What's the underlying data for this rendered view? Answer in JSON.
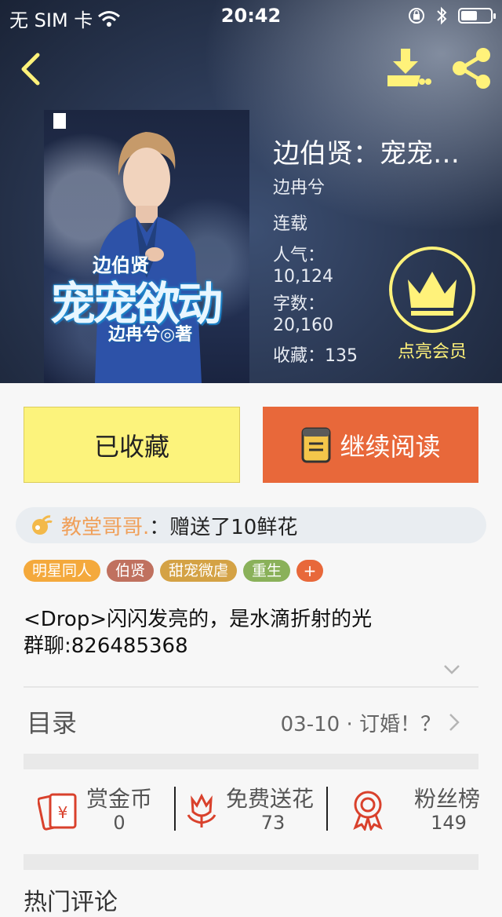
{
  "status_bar": {
    "carrier": "无 SIM 卡",
    "time": "20:42",
    "battery_level": 0.6
  },
  "book": {
    "title": "边伯贤：宠宠欲动",
    "author": "边冉兮",
    "serial_status": "连载",
    "popularity_label": "人气：",
    "popularity_value": "10,124",
    "words_label": "字数：",
    "words_value": "20,160",
    "favorites_text": "收藏：135",
    "cover": {
      "title_small": "边伯贤",
      "title_large": "宠宠欲动",
      "author_line": "边冉兮◎著"
    }
  },
  "vip": {
    "label": "点亮会员",
    "icon": "crown-icon"
  },
  "actions": {
    "favorited_label": "已收藏",
    "continue_label": "继续阅读"
  },
  "gift_notice": {
    "user": "教堂哥哥.",
    "message": "：赠送了10鲜花"
  },
  "tags": [
    {
      "label": "明星同人",
      "color": "#f4a93c"
    },
    {
      "label": "伯贤",
      "color": "#c0715f"
    },
    {
      "label": "甜宠微虐",
      "color": "#d4a245"
    },
    {
      "label": "重生",
      "color": "#8ab15a"
    },
    {
      "label": "+",
      "color": "#e8683a"
    }
  ],
  "description": {
    "line1": "<Drop>闪闪发亮的，是水滴折射的光",
    "line2": "群聊:826485368"
  },
  "toc": {
    "label": "目录",
    "latest_chapter": "03-10 · 订婚！？"
  },
  "stats": [
    {
      "label": "赏金币",
      "value": "0",
      "icon": "reward-coin-icon"
    },
    {
      "label": "免费送花",
      "value": "73",
      "icon": "flower-icon"
    },
    {
      "label": "粉丝榜",
      "value": "149",
      "icon": "medal-icon"
    }
  ],
  "next_section_peek": "热门评论",
  "colors": {
    "accent_yellow": "#fcf37c",
    "accent_orange": "#e8683a",
    "icon_yellow": "#fff27a",
    "stat_icon_red": "#d9412c"
  }
}
